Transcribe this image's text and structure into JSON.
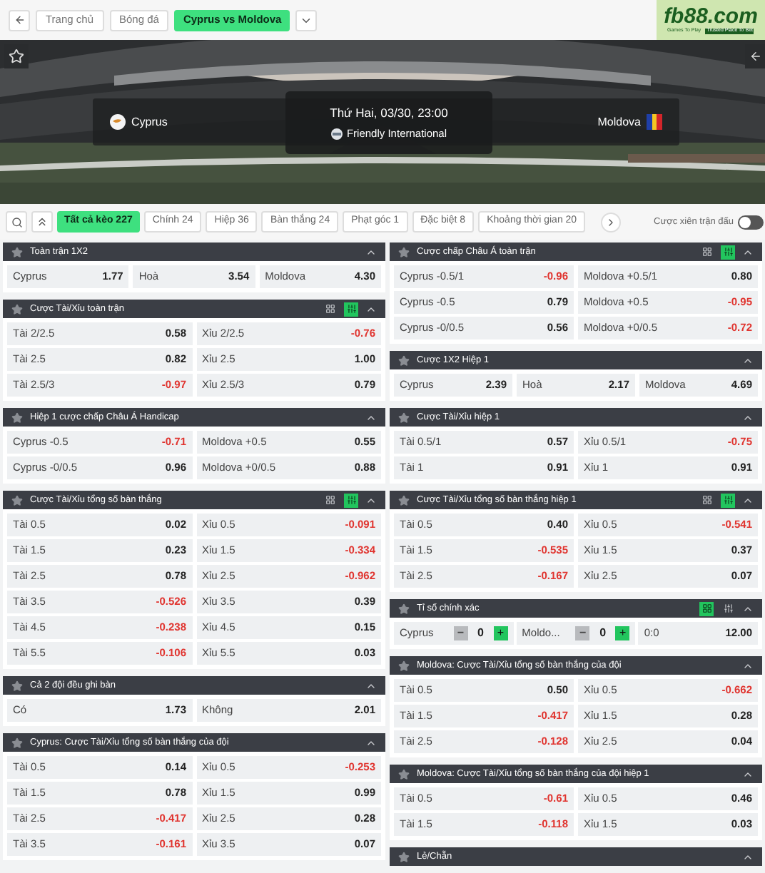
{
  "nav": {
    "crumbs": [
      {
        "label": "Trang chủ",
        "selected": false
      },
      {
        "label": "Bóng đá",
        "selected": false
      },
      {
        "label": "Cyprus vs Moldova",
        "selected": true
      }
    ]
  },
  "logo": {
    "text": "fb88.com",
    "tagline_1": "Games To Play",
    "tagline_2": "Trusted Place To Bet"
  },
  "match": {
    "home": "Cyprus",
    "away": "Moldova",
    "datetime": "Thứ Hai, 03/30, 23:00",
    "league": "Friendly International"
  },
  "tabs": [
    {
      "label": "Tất cả kèo 227",
      "selected": true
    },
    {
      "label": "Chính 24",
      "selected": false
    },
    {
      "label": "Hiệp 36",
      "selected": false
    },
    {
      "label": "Bàn thắng 24",
      "selected": false
    },
    {
      "label": "Phạt góc 1",
      "selected": false
    },
    {
      "label": "Đặc biệt 8",
      "selected": false
    },
    {
      "label": "Khoảng thời gian 20",
      "selected": false
    }
  ],
  "parlay_toggle": {
    "label": "Cược xiên trận đấu",
    "on": false
  },
  "left_column": [
    {
      "title": "Toàn trận 1X2",
      "rows": [
        {
          "kind": "triple",
          "cells": [
            {
              "label": "Cyprus",
              "odds": "1.77",
              "negative": false
            },
            {
              "label": "Hoà",
              "odds": "3.54",
              "negative": false
            },
            {
              "label": "Moldova",
              "odds": "4.30",
              "negative": false
            }
          ]
        }
      ]
    },
    {
      "title": "Cược Tài/Xỉu toàn trận",
      "views": [
        {
          "kind": "grid",
          "selected": false
        },
        {
          "kind": "list",
          "selected": true
        }
      ],
      "rows": [
        {
          "kind": "pair",
          "cells": [
            {
              "label": "Tài 2/2.5",
              "odds": "0.58",
              "negative": false
            },
            {
              "label": "Xỉu 2/2.5",
              "odds": "-0.76",
              "negative": true
            }
          ]
        },
        {
          "kind": "pair",
          "cells": [
            {
              "label": "Tài 2.5",
              "odds": "0.82",
              "negative": false
            },
            {
              "label": "Xỉu 2.5",
              "odds": "1.00",
              "negative": false
            }
          ]
        },
        {
          "kind": "pair",
          "cells": [
            {
              "label": "Tài 2.5/3",
              "odds": "-0.97",
              "negative": true
            },
            {
              "label": "Xỉu 2.5/3",
              "odds": "0.79",
              "negative": false
            }
          ]
        }
      ]
    },
    {
      "title": "Hiệp 1 cược chấp Châu Á Handicap",
      "rows": [
        {
          "kind": "pair",
          "cells": [
            {
              "label": "Cyprus -0.5",
              "odds": "-0.71",
              "negative": true
            },
            {
              "label": "Moldova +0.5",
              "odds": "0.55",
              "negative": false
            }
          ]
        },
        {
          "kind": "pair",
          "cells": [
            {
              "label": "Cyprus -0/0.5",
              "odds": "0.96",
              "negative": false
            },
            {
              "label": "Moldova +0/0.5",
              "odds": "0.88",
              "negative": false
            }
          ]
        }
      ]
    },
    {
      "title": "Cược Tài/Xỉu tổng số bàn thắng",
      "views": [
        {
          "kind": "grid",
          "selected": false
        },
        {
          "kind": "list",
          "selected": true
        }
      ],
      "rows": [
        {
          "kind": "pair",
          "cells": [
            {
              "label": "Tài 0.5",
              "odds": "0.02",
              "negative": false
            },
            {
              "label": "Xỉu 0.5",
              "odds": "-0.091",
              "negative": true
            }
          ]
        },
        {
          "kind": "pair",
          "cells": [
            {
              "label": "Tài 1.5",
              "odds": "0.23",
              "negative": false
            },
            {
              "label": "Xỉu 1.5",
              "odds": "-0.334",
              "negative": true
            }
          ]
        },
        {
          "kind": "pair",
          "cells": [
            {
              "label": "Tài 2.5",
              "odds": "0.78",
              "negative": false
            },
            {
              "label": "Xỉu 2.5",
              "odds": "-0.962",
              "negative": true
            }
          ]
        },
        {
          "kind": "pair",
          "cells": [
            {
              "label": "Tài 3.5",
              "odds": "-0.526",
              "negative": true
            },
            {
              "label": "Xỉu 3.5",
              "odds": "0.39",
              "negative": false
            }
          ]
        },
        {
          "kind": "pair",
          "cells": [
            {
              "label": "Tài 4.5",
              "odds": "-0.238",
              "negative": true
            },
            {
              "label": "Xỉu 4.5",
              "odds": "0.15",
              "negative": false
            }
          ]
        },
        {
          "kind": "pair",
          "cells": [
            {
              "label": "Tài 5.5",
              "odds": "-0.106",
              "negative": true
            },
            {
              "label": "Xỉu 5.5",
              "odds": "0.03",
              "negative": false
            }
          ]
        }
      ]
    },
    {
      "title": "Cả 2 đội đều ghi bàn",
      "rows": [
        {
          "kind": "pair",
          "cells": [
            {
              "label": "Có",
              "odds": "1.73",
              "negative": false
            },
            {
              "label": "Không",
              "odds": "2.01",
              "negative": false
            }
          ]
        }
      ]
    },
    {
      "title": "Cyprus: Cược Tài/Xỉu tổng số bàn thắng của đội",
      "rows": [
        {
          "kind": "pair",
          "cells": [
            {
              "label": "Tài 0.5",
              "odds": "0.14",
              "negative": false
            },
            {
              "label": "Xỉu 0.5",
              "odds": "-0.253",
              "negative": true
            }
          ]
        },
        {
          "kind": "pair",
          "cells": [
            {
              "label": "Tài 1.5",
              "odds": "0.78",
              "negative": false
            },
            {
              "label": "Xỉu 1.5",
              "odds": "0.99",
              "negative": false
            }
          ]
        },
        {
          "kind": "pair",
          "cells": [
            {
              "label": "Tài 2.5",
              "odds": "-0.417",
              "negative": true
            },
            {
              "label": "Xỉu 2.5",
              "odds": "0.28",
              "negative": false
            }
          ]
        },
        {
          "kind": "pair",
          "cells": [
            {
              "label": "Tài 3.5",
              "odds": "-0.161",
              "negative": true
            },
            {
              "label": "Xỉu 3.5",
              "odds": "0.07",
              "negative": false
            }
          ]
        }
      ]
    }
  ],
  "right_column": [
    {
      "title": "Cược chấp Châu Á toàn trận",
      "views": [
        {
          "kind": "grid",
          "selected": false
        },
        {
          "kind": "list",
          "selected": true
        }
      ],
      "rows": [
        {
          "kind": "pair",
          "cells": [
            {
              "label": "Cyprus -0.5/1",
              "odds": "-0.96",
              "negative": true
            },
            {
              "label": "Moldova +0.5/1",
              "odds": "0.80",
              "negative": false
            }
          ]
        },
        {
          "kind": "pair",
          "cells": [
            {
              "label": "Cyprus -0.5",
              "odds": "0.79",
              "negative": false
            },
            {
              "label": "Moldova +0.5",
              "odds": "-0.95",
              "negative": true
            }
          ]
        },
        {
          "kind": "pair",
          "cells": [
            {
              "label": "Cyprus -0/0.5",
              "odds": "0.56",
              "negative": false
            },
            {
              "label": "Moldova +0/0.5",
              "odds": "-0.72",
              "negative": true
            }
          ]
        }
      ]
    },
    {
      "title": "Cược 1X2 Hiệp 1",
      "rows": [
        {
          "kind": "triple",
          "cells": [
            {
              "label": "Cyprus",
              "odds": "2.39",
              "negative": false
            },
            {
              "label": "Hoà",
              "odds": "2.17",
              "negative": false
            },
            {
              "label": "Moldova",
              "odds": "4.69",
              "negative": false
            }
          ]
        }
      ]
    },
    {
      "title": "Cược Tài/Xỉu hiệp 1",
      "rows": [
        {
          "kind": "pair",
          "cells": [
            {
              "label": "Tài 0.5/1",
              "odds": "0.57",
              "negative": false
            },
            {
              "label": "Xỉu 0.5/1",
              "odds": "-0.75",
              "negative": true
            }
          ]
        },
        {
          "kind": "pair",
          "cells": [
            {
              "label": "Tài 1",
              "odds": "0.91",
              "negative": false
            },
            {
              "label": "Xỉu 1",
              "odds": "0.91",
              "negative": false
            }
          ]
        }
      ]
    },
    {
      "title": "Cược Tài/Xỉu tổng số bàn thắng hiệp 1",
      "views": [
        {
          "kind": "grid",
          "selected": false
        },
        {
          "kind": "list",
          "selected": true
        }
      ],
      "rows": [
        {
          "kind": "pair",
          "cells": [
            {
              "label": "Tài 0.5",
              "odds": "0.40",
              "negative": false
            },
            {
              "label": "Xỉu 0.5",
              "odds": "-0.541",
              "negative": true
            }
          ]
        },
        {
          "kind": "pair",
          "cells": [
            {
              "label": "Tài 1.5",
              "odds": "-0.535",
              "negative": true
            },
            {
              "label": "Xỉu 1.5",
              "odds": "0.37",
              "negative": false
            }
          ]
        },
        {
          "kind": "pair",
          "cells": [
            {
              "label": "Tài 2.5",
              "odds": "-0.167",
              "negative": true
            },
            {
              "label": "Xỉu 2.5",
              "odds": "0.07",
              "negative": false
            }
          ]
        }
      ]
    },
    {
      "title": "Tỉ số chính xác",
      "views": [
        {
          "kind": "grid",
          "selected": true
        },
        {
          "kind": "list",
          "selected": false
        }
      ],
      "rows": [
        {
          "kind": "score",
          "teams": [
            {
              "name": "Cyprus",
              "score": "0",
              "minus": "−",
              "plus": "+"
            },
            {
              "name": "Moldo...",
              "score": "0",
              "minus": "−",
              "plus": "+"
            }
          ],
          "result": "0:0",
          "odds": "12.00"
        }
      ]
    },
    {
      "title": "Moldova: Cược Tài/Xỉu tổng số bàn thắng của đội",
      "rows": [
        {
          "kind": "pair",
          "cells": [
            {
              "label": "Tài 0.5",
              "odds": "0.50",
              "negative": false
            },
            {
              "label": "Xỉu 0.5",
              "odds": "-0.662",
              "negative": true
            }
          ]
        },
        {
          "kind": "pair",
          "cells": [
            {
              "label": "Tài 1.5",
              "odds": "-0.417",
              "negative": true
            },
            {
              "label": "Xỉu 1.5",
              "odds": "0.28",
              "negative": false
            }
          ]
        },
        {
          "kind": "pair",
          "cells": [
            {
              "label": "Tài 2.5",
              "odds": "-0.128",
              "negative": true
            },
            {
              "label": "Xỉu 2.5",
              "odds": "0.04",
              "negative": false
            }
          ]
        }
      ]
    },
    {
      "title": "Moldova: Cược Tài/Xỉu tổng số bàn thắng của đội hiệp 1",
      "rows": [
        {
          "kind": "pair",
          "cells": [
            {
              "label": "Tài 0.5",
              "odds": "-0.61",
              "negative": true
            },
            {
              "label": "Xỉu 0.5",
              "odds": "0.46",
              "negative": false
            }
          ]
        },
        {
          "kind": "pair",
          "cells": [
            {
              "label": "Tài 1.5",
              "odds": "-0.118",
              "negative": true
            },
            {
              "label": "Xỉu 1.5",
              "odds": "0.03",
              "negative": false
            }
          ]
        }
      ]
    },
    {
      "title": "Lẻ/Chẵn"
    }
  ]
}
